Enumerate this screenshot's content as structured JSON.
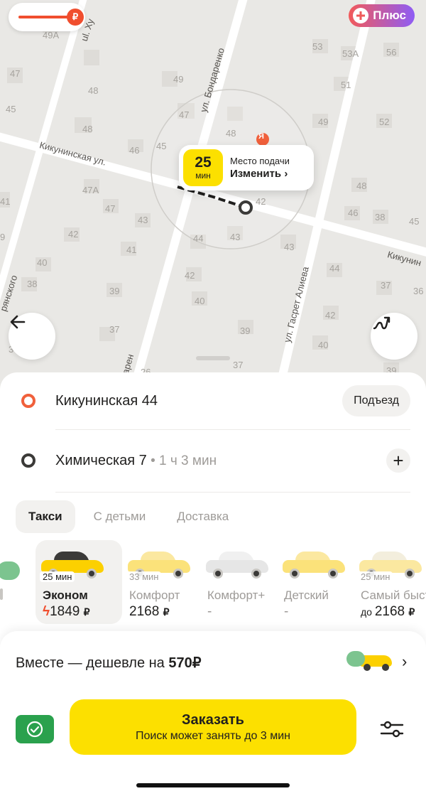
{
  "map": {
    "house_numbers": [
      "49А",
      "47",
      "48",
      "45",
      "48",
      "49",
      "47",
      "48",
      "46",
      "45",
      "47А",
      "47",
      "43",
      "42",
      "41",
      "42",
      "40",
      "38",
      "39",
      "37",
      "44",
      "43",
      "42",
      "40",
      "39",
      "37",
      "43",
      "44",
      "42",
      "40",
      "53",
      "53А",
      "56",
      "51",
      "49",
      "52",
      "48",
      "46",
      "38",
      "45",
      "37",
      "36",
      "39",
      "41",
      "9",
      "3",
      "26",
      "Я"
    ],
    "streets": {
      "kikuninskaya": "Кикунинская ул.",
      "bondarenko": "ул. Бондаренко",
      "bondarenko_bottom": "дарен",
      "aliyeva": "ул. Гасрет Алиева",
      "khu": "ul. Ху",
      "kikunin_right": "Кикунин",
      "partial_left": "рянского"
    },
    "eta": {
      "minutes": "25",
      "unit": "мин",
      "title": "Место подачи",
      "action": "Изменить ›"
    },
    "plus_label": "Плюс",
    "payment_icon": "ruble-bolt-icon"
  },
  "route": {
    "from": {
      "address": "Кикунинская 44",
      "entrance_label": "Подъезд",
      "dot_color": "#f0603b"
    },
    "to": {
      "address": "Химическая 7",
      "duration": " • 1 ч 3 мин",
      "dot_color": "#3b3a38"
    }
  },
  "tabs": [
    {
      "label": "Такси",
      "active": true
    },
    {
      "label": "С детьми",
      "active": false
    },
    {
      "label": "Доставка",
      "active": false
    }
  ],
  "tariffs": [
    {
      "time": "25 мин",
      "name": "Эконом",
      "price_prefix": "",
      "price": "1849",
      "currency": "₽",
      "bolt": "ϟ",
      "active": true,
      "car_color": "#fcd000"
    },
    {
      "time": "33 мин",
      "name": "Комфорт",
      "price_prefix": "",
      "price": "2168",
      "currency": "₽",
      "bolt": "",
      "active": false,
      "car_color": "#fbe27a"
    },
    {
      "time": "",
      "name": "Комфорт+",
      "price_prefix": "",
      "price": "-",
      "currency": "",
      "bolt": "",
      "active": false,
      "car_color": "#e6e6e6"
    },
    {
      "time": "",
      "name": "Детский",
      "price_prefix": "",
      "price": "-",
      "currency": "",
      "bolt": "",
      "active": false,
      "car_color": "#fbe27a"
    },
    {
      "time": "25 мин",
      "name": "Самый быстрый",
      "price_prefix": "до ",
      "price": "2168",
      "currency": "₽",
      "bolt": "",
      "active": false,
      "car_color": "#fbe8a0"
    }
  ],
  "together": {
    "text": "Вместе — дешевле на ",
    "amount": "570₽"
  },
  "order": {
    "title": "Заказать",
    "subtitle": "Поиск может занять до 3 мин"
  },
  "colors": {
    "accent": "#fce000",
    "green": "#2aa14d",
    "origin": "#f0603b"
  }
}
